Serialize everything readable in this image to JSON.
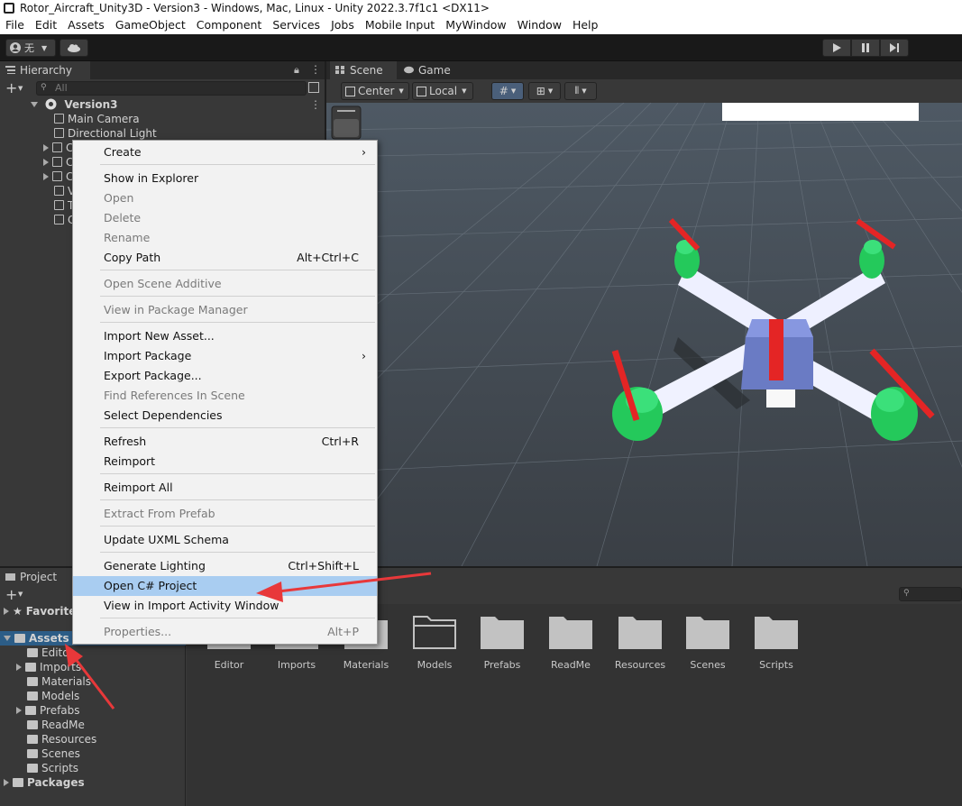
{
  "window": {
    "title": "Rotor_Aircraft_Unity3D - Version3 - Windows, Mac, Linux - Unity 2022.3.7f1c1 <DX11>"
  },
  "menubar": [
    "File",
    "Edit",
    "Assets",
    "GameObject",
    "Component",
    "Services",
    "Jobs",
    "Mobile Input",
    "MyWindow",
    "Window",
    "Help"
  ],
  "toolbar": {
    "account_label": "无"
  },
  "hierarchy": {
    "tab_label": "Hierarchy",
    "search_placeholder": "All",
    "scene_name": "Version3",
    "items": [
      "Main Camera",
      "Directional Light"
    ],
    "collapsed_prefix": [
      "C",
      "C",
      "C",
      "V",
      "T",
      "C"
    ]
  },
  "scene": {
    "tabs": [
      "Scene",
      "Game"
    ],
    "pivot_label": "Center",
    "space_label": "Local"
  },
  "context_menu": {
    "items": [
      {
        "label": "Create",
        "submenu": true
      },
      {
        "label": "Show in Explorer"
      },
      {
        "label": "Open",
        "disabled": true
      },
      {
        "label": "Delete",
        "disabled": true
      },
      {
        "label": "Rename",
        "disabled": true
      },
      {
        "label": "Copy Path",
        "shortcut": "Alt+Ctrl+C"
      },
      {
        "label": "Open Scene Additive",
        "disabled": true
      },
      {
        "label": "View in Package Manager",
        "disabled": true
      },
      {
        "label": "Import New Asset..."
      },
      {
        "label": "Import Package",
        "submenu": true
      },
      {
        "label": "Export Package..."
      },
      {
        "label": "Find References In Scene",
        "disabled": true
      },
      {
        "label": "Select Dependencies"
      },
      {
        "label": "Refresh",
        "shortcut": "Ctrl+R"
      },
      {
        "label": "Reimport"
      },
      {
        "label": "Reimport All"
      },
      {
        "label": "Extract From Prefab",
        "disabled": true
      },
      {
        "label": "Update UXML Schema"
      },
      {
        "label": "Generate Lighting",
        "shortcut": "Ctrl+Shift+L"
      },
      {
        "label": "Open C# Project",
        "highlighted": true
      },
      {
        "label": "View in Import Activity Window"
      },
      {
        "label": "Properties...",
        "shortcut": "Alt+P",
        "disabled": true
      }
    ]
  },
  "project": {
    "tab_label": "Project",
    "tree": {
      "favorites": "Favorites",
      "assets": "Assets",
      "children": [
        "Editor",
        "Imports",
        "Materials",
        "Models",
        "Prefabs",
        "ReadMe",
        "Resources",
        "Scenes",
        "Scripts"
      ],
      "packages": "Packages"
    },
    "folders": [
      "Editor",
      "Imports",
      "Materials",
      "Models",
      "Prefabs",
      "ReadMe",
      "Resources",
      "Scenes",
      "Scripts"
    ]
  },
  "colors": {
    "highlight": "#a9cdf1",
    "drone_body": "#7f8fd6",
    "drone_motor": "#2fd36a",
    "drone_blade": "#e02525",
    "annotation_arrow": "#e8383a"
  }
}
